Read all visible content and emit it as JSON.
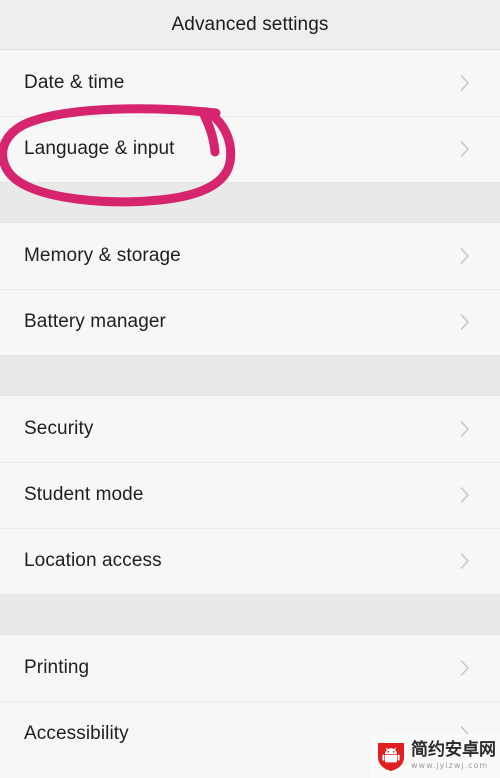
{
  "header": {
    "title": "Advanced settings"
  },
  "colors": {
    "page_background": "#f7f7f7",
    "header_background": "#eeeeee",
    "group_spacer": "#e9e9e9",
    "row_text": "#1f1f1f",
    "divider": "#ebebeb",
    "chevron": "#c8c8c8",
    "annotation_ink": "#d6246e",
    "watermark_logo": "#e02020"
  },
  "list": {
    "groups": [
      {
        "rows": [
          {
            "label": "Date & time",
            "chevron": "chevron-right-icon",
            "highlighted": false
          },
          {
            "label": "Language & input",
            "chevron": "chevron-right-icon",
            "highlighted": true
          }
        ]
      },
      {
        "rows": [
          {
            "label": "Memory & storage",
            "chevron": "chevron-right-icon",
            "highlighted": false
          },
          {
            "label": "Battery manager",
            "chevron": "chevron-right-icon",
            "highlighted": false
          }
        ]
      },
      {
        "rows": [
          {
            "label": "Security",
            "chevron": "chevron-right-icon",
            "highlighted": false
          },
          {
            "label": "Student mode",
            "chevron": "chevron-right-icon",
            "highlighted": false
          },
          {
            "label": "Location access",
            "chevron": "chevron-right-icon",
            "highlighted": false
          }
        ]
      },
      {
        "rows": [
          {
            "label": "Printing",
            "chevron": "chevron-right-icon",
            "highlighted": false
          },
          {
            "label": "Accessibility",
            "chevron": "chevron-right-icon",
            "highlighted": false
          }
        ]
      }
    ]
  },
  "annotation": {
    "type": "hand-drawn-ellipse",
    "target_label": "Language & input",
    "ink_color": "#d6246e",
    "stroke_width": 9
  },
  "watermark": {
    "logo": "android-shield-icon",
    "site_name": "简约安卓网",
    "url": "www.jylzwj.com"
  }
}
